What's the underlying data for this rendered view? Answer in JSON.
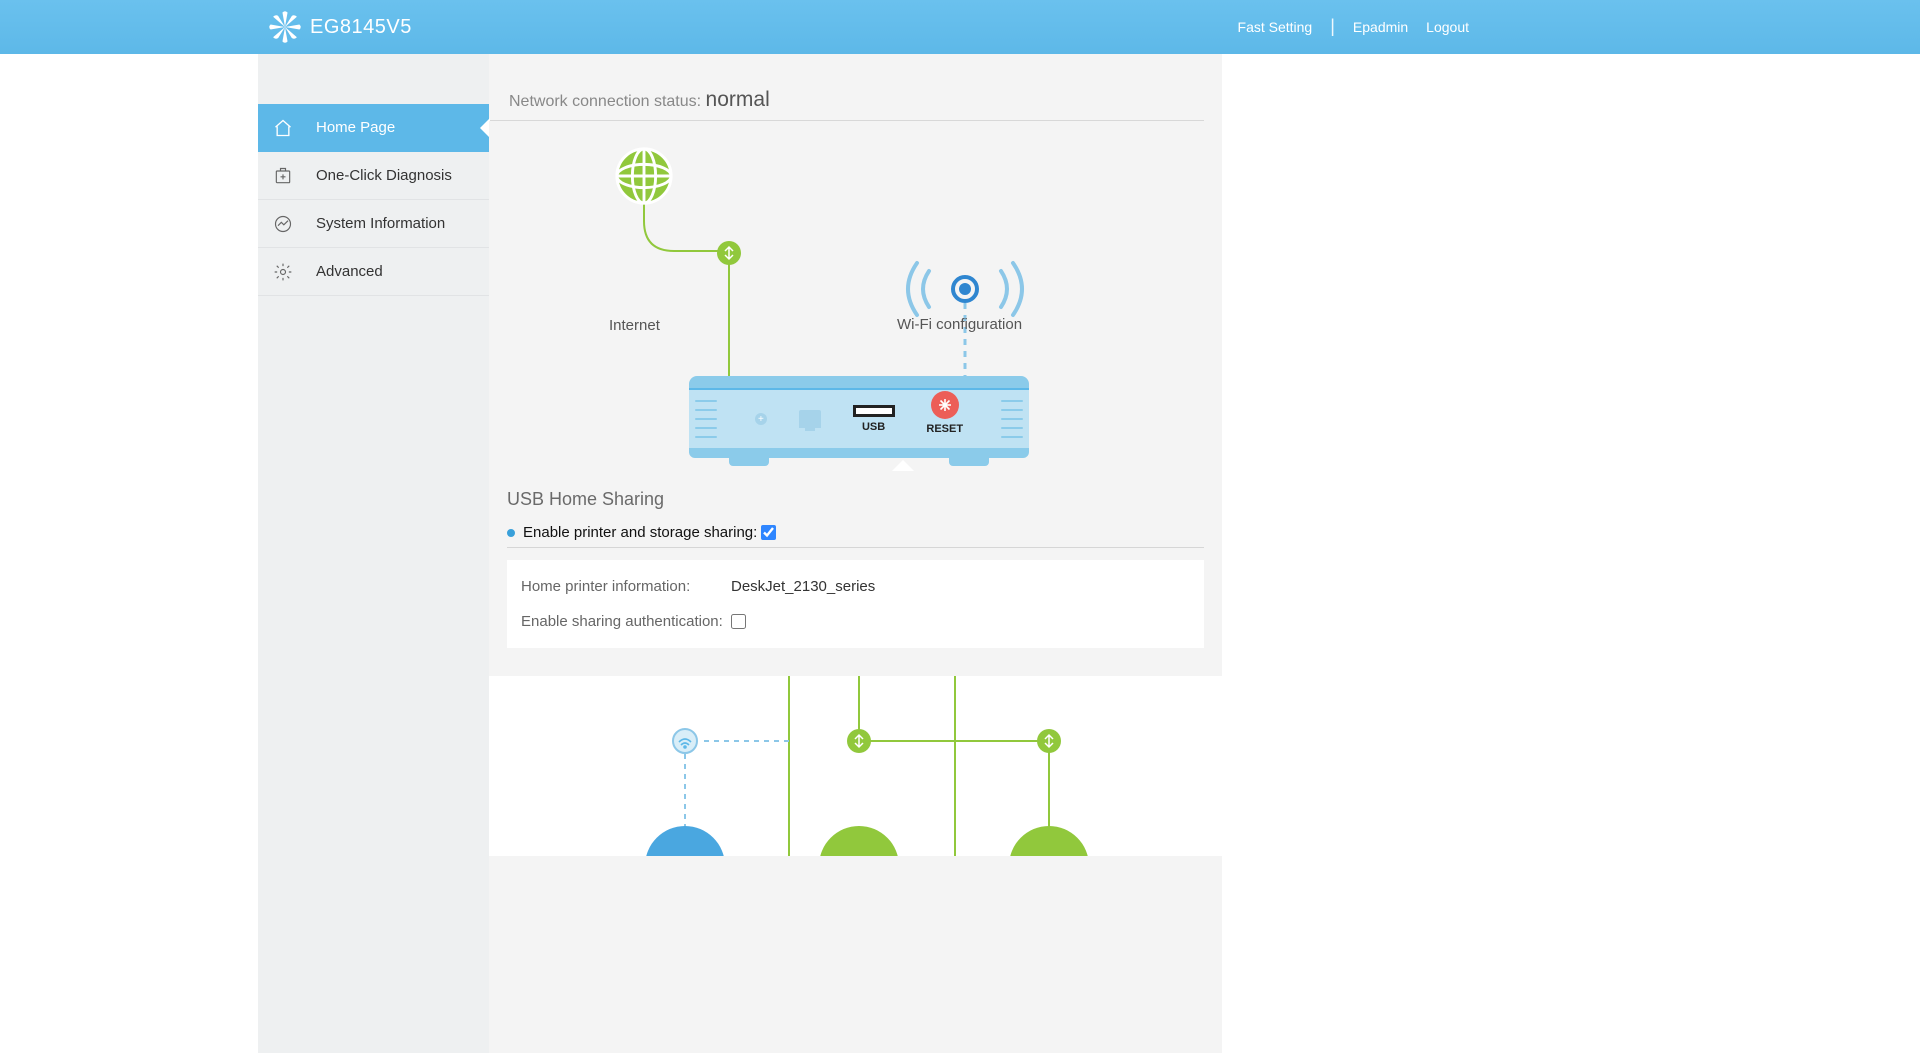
{
  "header": {
    "product_name": "EG8145V5",
    "links": {
      "fast_setting": "Fast Setting",
      "user": "Epadmin",
      "logout": "Logout"
    }
  },
  "sidebar": {
    "items": [
      {
        "label": "Home Page",
        "icon": "home"
      },
      {
        "label": "One-Click Diagnosis",
        "icon": "diagnosis"
      },
      {
        "label": "System Information",
        "icon": "sysinfo"
      },
      {
        "label": "Advanced",
        "icon": "gear"
      }
    ],
    "active_index": 0
  },
  "status": {
    "label": "Network connection status:",
    "value": "normal"
  },
  "diagram": {
    "internet_label": "Internet",
    "wifi_label": "Wi-Fi configuration",
    "usb_label": "USB",
    "reset_label": "RESET"
  },
  "usb_sharing": {
    "title": "USB Home Sharing",
    "enable_label": "Enable printer and storage sharing:",
    "enable_checked": true,
    "printer_info_label": "Home printer information:",
    "printer_info_value": "DeskJet_2130_series",
    "auth_label": "Enable sharing authentication:",
    "auth_checked": false
  }
}
